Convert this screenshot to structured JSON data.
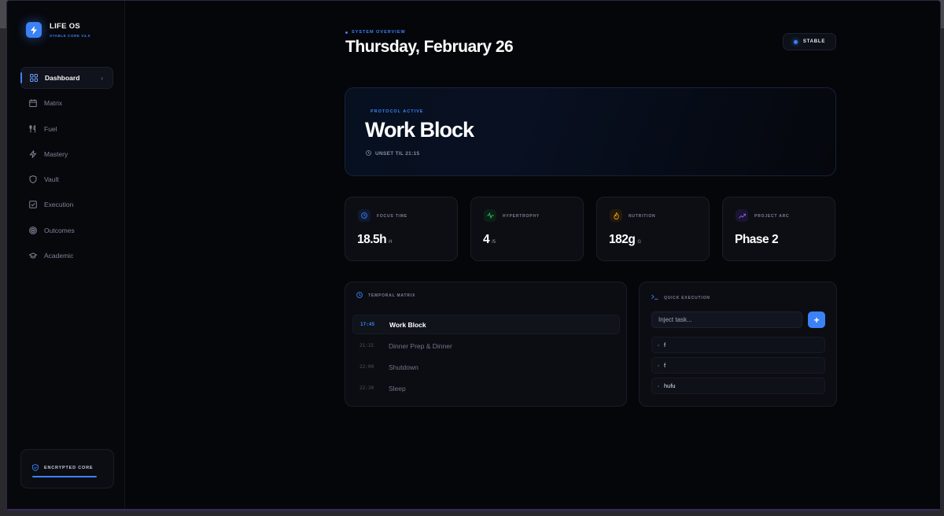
{
  "brand": {
    "name": "LIFE OS",
    "version": "STABLE CORE V4.0"
  },
  "sidebar": {
    "items": [
      {
        "label": "Dashboard",
        "icon": "grid-icon",
        "active": true
      },
      {
        "label": "Matrix",
        "icon": "calendar-icon"
      },
      {
        "label": "Fuel",
        "icon": "utensils-icon"
      },
      {
        "label": "Mastery",
        "icon": "lightning-icon"
      },
      {
        "label": "Vault",
        "icon": "shield-icon"
      },
      {
        "label": "Execution",
        "icon": "checkbox-icon"
      },
      {
        "label": "Outcomes",
        "icon": "target-icon"
      },
      {
        "label": "Academic",
        "icon": "graduation-cap-icon"
      }
    ],
    "footer": {
      "label": "ENCRYPTED CORE"
    }
  },
  "header": {
    "eyebrow": "SYSTEM OVERVIEW",
    "title": "Thursday, February 26",
    "status": "STABLE"
  },
  "hero": {
    "kicker": "PROTOCOL ACTIVE",
    "title": "Work Block",
    "until": "UNSET TIL 21:15"
  },
  "stats": [
    {
      "label": "FOCUS TIME",
      "value": "18.5h",
      "unit": "H",
      "icon": "clock-icon",
      "color": "#3b82f6"
    },
    {
      "label": "HYPERTROPHY",
      "value": "4",
      "unit": "/5",
      "icon": "activity-icon",
      "color": "#22c55e"
    },
    {
      "label": "NUTRITION",
      "value": "182g",
      "unit": "G",
      "icon": "flame-icon",
      "color": "#f59e0b"
    },
    {
      "label": "PROJECT ARC",
      "value": "Phase 2",
      "unit": "",
      "icon": "trending-up-icon",
      "color": "#8b5cf6"
    }
  ],
  "schedule": {
    "title": "TEMPORAL MATRIX",
    "rows": [
      {
        "time": "17:45",
        "task": "Work Block",
        "active": true
      },
      {
        "time": "21:15",
        "task": "Dinner Prep & Dinner"
      },
      {
        "time": "22:00",
        "task": "Shutdown"
      },
      {
        "time": "22:30",
        "task": "Sleep"
      }
    ]
  },
  "quick": {
    "title": "QUICK EXECUTION",
    "placeholder": "Inject task...",
    "add_label": "+",
    "items": [
      "f",
      "f",
      "hufu"
    ]
  }
}
